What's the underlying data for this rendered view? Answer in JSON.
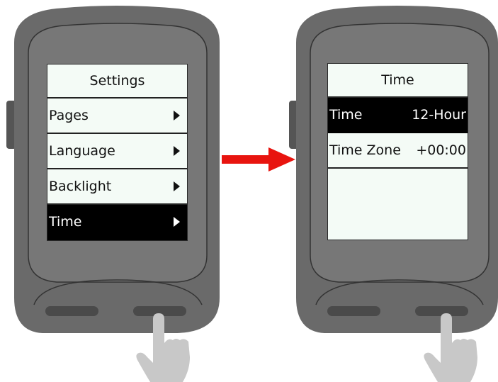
{
  "left_screen": {
    "title": "Settings",
    "items": [
      {
        "label": "Pages",
        "selected": false
      },
      {
        "label": "Language",
        "selected": false
      },
      {
        "label": "Backlight",
        "selected": false
      },
      {
        "label": "Time",
        "selected": true
      }
    ]
  },
  "right_screen": {
    "title": "Time",
    "items": [
      {
        "label": "Time",
        "value": "12-Hour",
        "selected": true
      },
      {
        "label": "Time Zone",
        "value": "+00:00",
        "selected": false
      }
    ]
  },
  "colors": {
    "device_body": "#6a6a6a",
    "device_rim": "#7a7a7a",
    "screen_bg": "#f4fbf6",
    "selection": "#000000",
    "transition_arrow": "#e8140f",
    "hand": "#c8c8c8"
  }
}
